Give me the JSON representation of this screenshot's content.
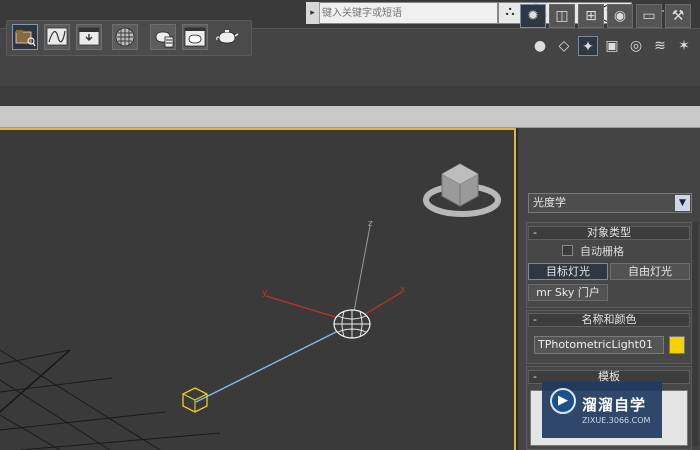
{
  "search": {
    "placeholder": "键入关键字或短语",
    "arrow": "▸"
  },
  "infocenter": {
    "icons": [
      "binoculars-icon",
      "key-icon",
      "satellite-icon",
      "star-icon",
      "help-icon"
    ],
    "glyphs": [
      "⛬",
      "🔧",
      "✎",
      "☆",
      "?"
    ],
    "dropdown": "▾"
  },
  "window": {
    "minimize": "−",
    "restore": "❐"
  },
  "toolbar": {
    "buttons": [
      "scene-explorer",
      "curve-editor",
      "render-setup",
      "material-editor",
      "render-frame",
      "render-production",
      "render-iterative"
    ]
  },
  "command_panel": {
    "tabs": [
      "create-tab",
      "modify-tab",
      "hierarchy-tab",
      "motion-tab",
      "display-tab",
      "utilities-tab"
    ],
    "tab_glyphs": [
      "✹",
      "◫",
      "⊞",
      "◉",
      "▭",
      "⚒"
    ],
    "subcategory_glyphs": [
      "●",
      "◇",
      "✦",
      "▣",
      "◎",
      "≋",
      "✶"
    ],
    "category": "光度学",
    "object_type": {
      "header": "对象类型",
      "autogrid": "自动栅格",
      "buttons": [
        "目标灯光",
        "自由灯光",
        "mr Sky 门户"
      ]
    },
    "name_color": {
      "header": "名称和颜色",
      "name": "TPhotometricLight01",
      "color": "#f4d400"
    },
    "template": {
      "header": "模板"
    },
    "minus": "-"
  },
  "viewport": {
    "axis_labels": {
      "x": "x",
      "y": "y",
      "z": "z"
    },
    "border_color": "#e0b63b"
  },
  "watermark": {
    "title": "溜溜自学",
    "url": "ZIXUE.3066.COM",
    "logo": "▶"
  }
}
